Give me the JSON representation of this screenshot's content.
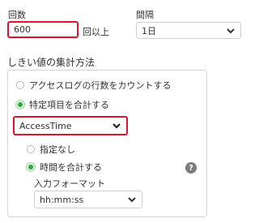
{
  "count": {
    "label": "回数",
    "value": "600",
    "suffix": "回以上"
  },
  "interval": {
    "label": "間隔",
    "selected": "1日"
  },
  "aggregation": {
    "title": "しきい値の集計方法",
    "option_count_lines": "アクセスログの行数をカウントする",
    "option_sum_item": "特定項目を合計する",
    "item_select": {
      "selected": "AccessTime"
    },
    "sub_option_none": "指定なし",
    "sub_option_time_sum": "時間を合計する",
    "input_format": {
      "label": "入力フォーマット",
      "selected": "hh:mm:ss"
    },
    "help_symbol": "?"
  },
  "colors": {
    "highlight": "#e0142c",
    "radio_checked": "#2eab3d"
  }
}
